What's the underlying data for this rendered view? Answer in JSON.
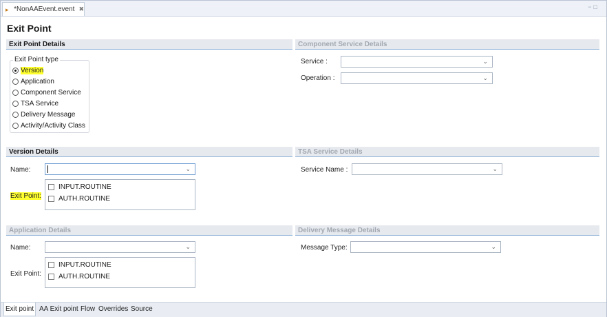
{
  "editor": {
    "tab_label": "*NonAAEvent.event",
    "close_glyph": "✖"
  },
  "page_title": "Exit Point",
  "exit_point_details": {
    "header": "Exit Point Details",
    "legend": "Exit Point type",
    "options": [
      "Version",
      "Application",
      "Component Service",
      "TSA Service",
      "Delivery Message",
      "Activity/Activity Class"
    ],
    "selected": "Version"
  },
  "component_service_details": {
    "header": "Component Service Details",
    "service_label": "Service :",
    "service_value": "",
    "operation_label": "Operation :",
    "operation_value": ""
  },
  "version_details": {
    "header": "Version Details",
    "name_label": "Name:",
    "name_value": "",
    "exit_point_label": "Exit Point:",
    "routines": [
      "INPUT.ROUTINE",
      "AUTH.ROUTINE"
    ]
  },
  "tsa_service_details": {
    "header": "TSA Service Details",
    "service_name_label": "Service Name :",
    "service_name_value": ""
  },
  "application_details": {
    "header": "Application Details",
    "name_label": "Name:",
    "name_value": "",
    "exit_point_label": "Exit Point:",
    "routines": [
      "INPUT.ROUTINE",
      "AUTH.ROUTINE"
    ]
  },
  "delivery_message_details": {
    "header": "Delivery Message Details",
    "message_type_label": "Message Type:",
    "message_type_value": ""
  },
  "bottom_tabs": [
    "Exit point",
    "AA Exit point",
    "Flow",
    "Overrides",
    "Source"
  ],
  "active_bottom_tab": "Exit point",
  "colors": {
    "highlight": "#ffff2e",
    "section_rule": "#8fb3d9",
    "section_bg": "#e6e9ee"
  },
  "icons": {
    "editor_tab": "event-file-icon",
    "dropdown": "chevron-down-icon",
    "window_controls": "minimize-maximize-icon"
  }
}
